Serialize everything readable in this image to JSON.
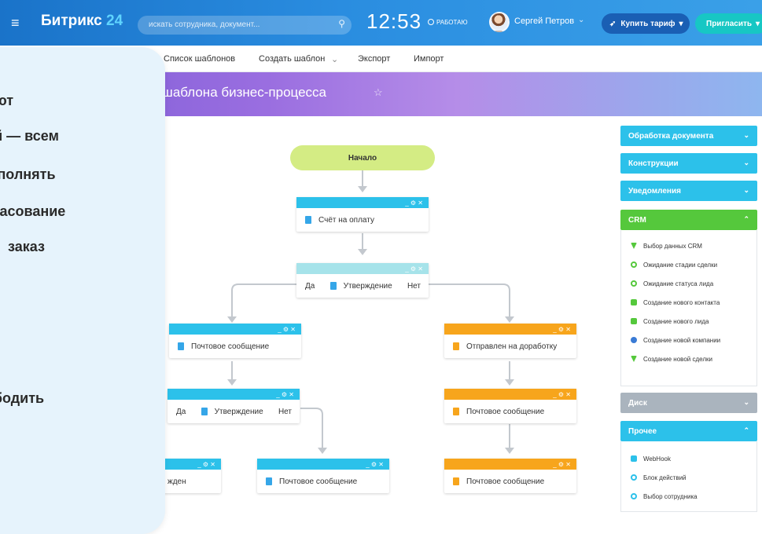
{
  "header": {
    "menu_icon": "≡",
    "logo_word": "Битрикс",
    "logo_num": "24",
    "search_placeholder": "искать сотрудника, документ...",
    "clock": "12:53",
    "work_status": "РАБОТАЮ",
    "user_name": "Сергей Петров",
    "buy_label": "Купить тариф",
    "invite_label": "Пригласить"
  },
  "subnav": {
    "tab_fragment": "а",
    "items": [
      "Список шаблонов",
      "Создать шаблон",
      "Экспорт",
      "Импорт"
    ]
  },
  "page_title": "е шаблона бизнес-процесса",
  "flow": {
    "start": "Начало",
    "invoice": "Счёт на оплату",
    "approval_yes": "Да",
    "approval": "Утверждение",
    "approval_no": "Нет",
    "mail1": "Почтовое сообщение",
    "revision": "Отправлен на доработку",
    "yes2": "Да",
    "approval2": "Утверждение",
    "no2": "Нет",
    "mail2": "Почтовое сообщение",
    "rejected_fragment": "жден",
    "mail3": "Почтовое сообщение",
    "mail4": "Почтовое сообщение",
    "bar_controls": "_  ⚙  ✕"
  },
  "panel": {
    "doc_processing": "Обработка документа",
    "constructs": "Конструкции",
    "notifications": "Уведомления",
    "crm": "CRM",
    "crm_items": [
      "Выбор данных CRM",
      "Ожидание стадии сделки",
      "Ожидание статуса лида",
      "Создание нового контакта",
      "Создание нового лида",
      "Создание новой компании",
      "Создание новой сделки"
    ],
    "disk": "Диск",
    "other": "Прочее",
    "other_items": [
      "WebHook",
      "Блок действий",
      "Выбор сотрудника"
    ]
  },
  "overlay": {
    "lines": [
      "меют",
      "бой — всем",
      "выполнять",
      "огласование",
      "заказ",
      "вободить",
      "от"
    ]
  },
  "colors": {
    "header_blue": "#1a73c9",
    "cyan": "#2cc1ea",
    "orange": "#f7a51c",
    "green": "#55c83c",
    "start_green": "#d4ec84",
    "title_purple": "#9a6ee0"
  }
}
